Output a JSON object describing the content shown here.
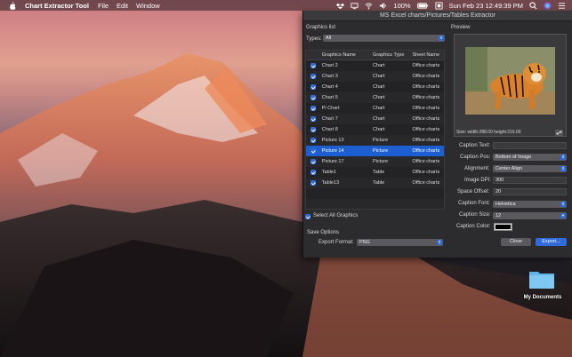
{
  "menubar": {
    "app_name": "Chart Extractor Tool",
    "menus": [
      "File",
      "Edit",
      "Window"
    ],
    "battery": "100%",
    "clock": "Sun Feb 23  12:49:39 PM"
  },
  "window": {
    "title": "MS Excel charts/Pictures/Tables Extractor",
    "graphics_list_label": "Graphics list",
    "types_label": "Types:",
    "types_value": "All",
    "columns": [
      "Graphics Name",
      "Graphics Type",
      "Sheet Name"
    ],
    "rows": [
      {
        "name": "Chart 2",
        "type": "Chart",
        "sheet": "Office charts",
        "checked": true
      },
      {
        "name": "Chart 3",
        "type": "Chart",
        "sheet": "Office charts",
        "checked": true
      },
      {
        "name": "Chart 4",
        "type": "Chart",
        "sheet": "Office charts",
        "checked": true
      },
      {
        "name": "Chart 5",
        "type": "Chart",
        "sheet": "Office charts",
        "checked": true
      },
      {
        "name": "Pi Chart",
        "type": "Chart",
        "sheet": "Office charts",
        "checked": true
      },
      {
        "name": "Chart 7",
        "type": "Chart",
        "sheet": "Office charts",
        "checked": true
      },
      {
        "name": "Chart 8",
        "type": "Chart",
        "sheet": "Office charts",
        "checked": true
      },
      {
        "name": "Picture 13",
        "type": "Picture",
        "sheet": "Office charts",
        "checked": true
      },
      {
        "name": "Picture 14",
        "type": "Picture",
        "sheet": "Office charts",
        "checked": true,
        "selected": true
      },
      {
        "name": "Picture 17",
        "type": "Picture",
        "sheet": "Office charts",
        "checked": true
      },
      {
        "name": "Table1",
        "type": "Table",
        "sheet": "Office charts",
        "checked": true
      },
      {
        "name": "Table13",
        "type": "Table",
        "sheet": "Office charts",
        "checked": true
      }
    ],
    "select_all_label": "Select All Graphics",
    "save_options_label": "Save Options",
    "export_format_label": "Export Format:",
    "export_format_value": "PNG",
    "preview_label": "Preview",
    "preview_info": "Size:   width:288.00  height:216.00",
    "caption_text_label": "Caption Text:",
    "caption_text_value": "",
    "caption_pos_label": "Caption Pos:",
    "caption_pos_value": "Bottom of Image",
    "alignment_label": "Alignment:",
    "alignment_value": "Center Align",
    "image_dpi_label": "Image DPI:",
    "image_dpi_value": "300",
    "space_offset_label": "Space Offset:",
    "space_offset_value": "20",
    "caption_font_label": "Caption Font:",
    "caption_font_value": "Helvetica",
    "caption_size_label": "Caption Size:",
    "caption_size_value": "12",
    "caption_color_label": "Caption Color:",
    "caption_color_value": "#000000",
    "close_label": "Close",
    "export_label": "Export..."
  },
  "desktop": {
    "folder_label": "My Documents"
  },
  "colors": {
    "accent": "#2f6bd9",
    "selection": "#1d5fd1",
    "window_bg": "#2c2c2e"
  }
}
